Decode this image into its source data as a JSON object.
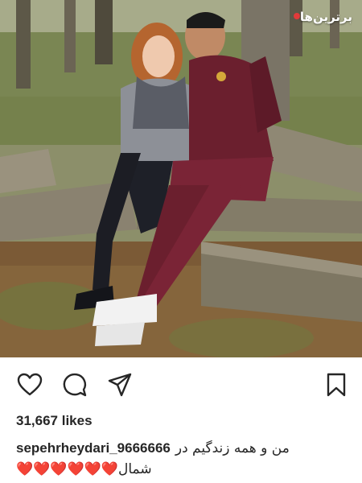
{
  "post": {
    "watermark": "برترین‌ها",
    "likes_text": "31,667 likes",
    "caption": {
      "username": "sepehrheydari_9666666",
      "text_line1": "من و همه زندگیم در",
      "hearts": "❤️❤️❤️❤️❤️❤️",
      "text_line2": "شمال"
    }
  },
  "actions": {
    "like_icon": "heart-outline-icon",
    "comment_icon": "comment-bubble-icon",
    "share_icon": "paper-plane-icon",
    "save_icon": "bookmark-icon"
  },
  "colors": {
    "text": "#262626",
    "heart": "#e0245e",
    "tracksuit": "#6b1f2e",
    "background": "#ffffff"
  }
}
